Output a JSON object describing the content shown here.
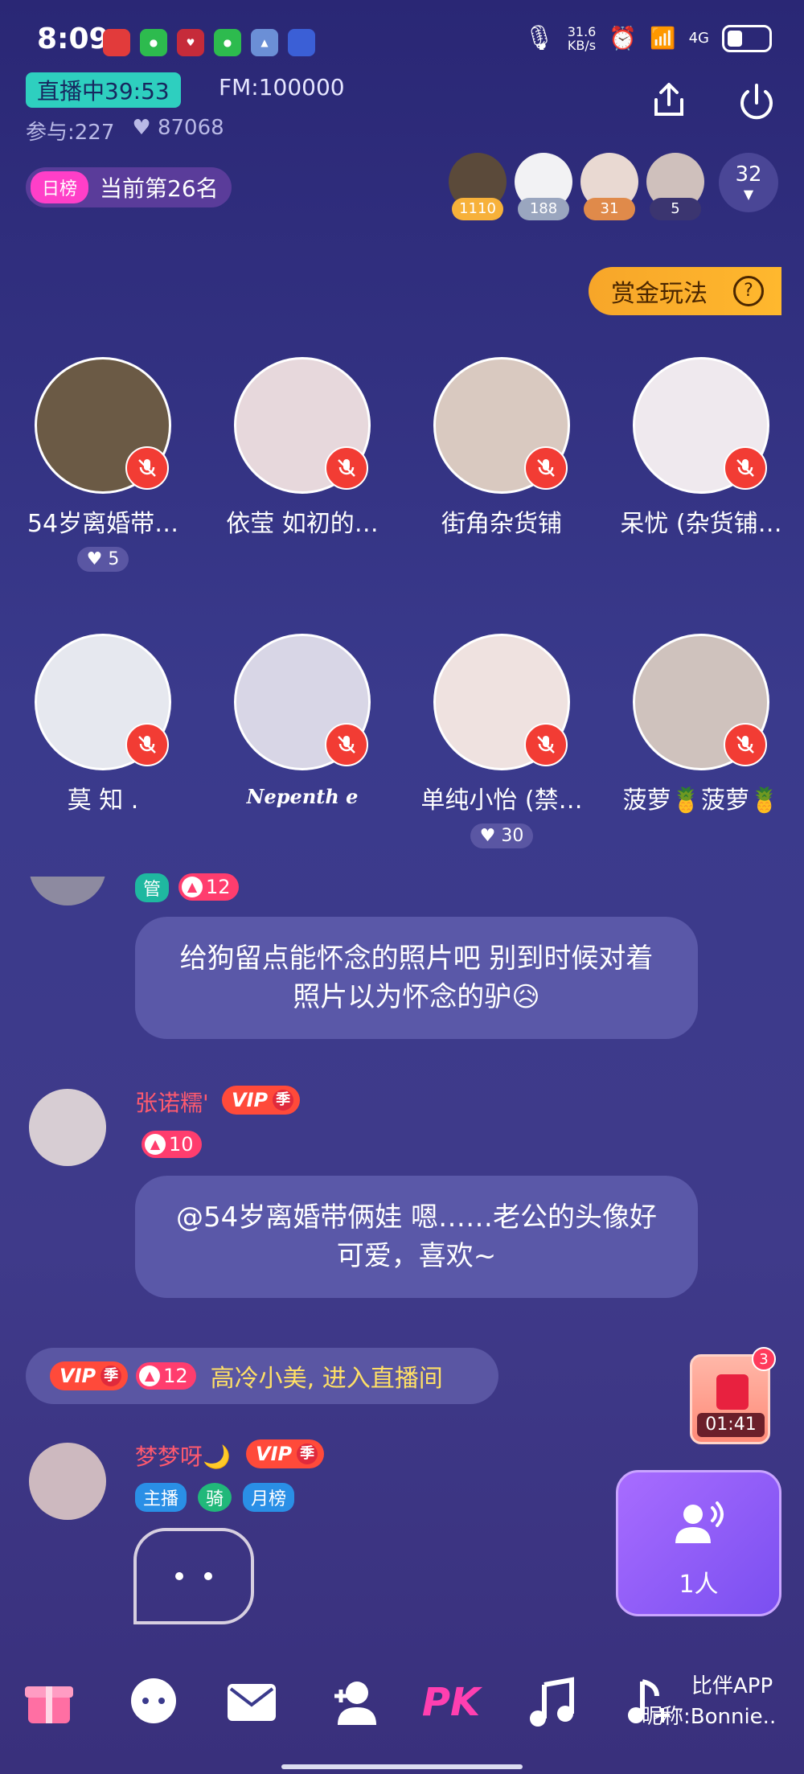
{
  "status_bar": {
    "time": "8:09",
    "net_speed_value": "31.6",
    "net_speed_unit": "KB/s",
    "signal": "4G"
  },
  "header": {
    "live_label": "直播中39:53",
    "fm_label": "FM:100000",
    "participants": "参与:227",
    "likes": "87068",
    "rank_tag": "日榜",
    "rank_text": "当前第26名",
    "viewer_count": "32",
    "top_viewers": [
      {
        "value": "1110",
        "color": "#f7b13a"
      },
      {
        "value": "188",
        "color": "#9aa6bf"
      },
      {
        "value": "31",
        "color": "#e08a4a"
      },
      {
        "value": "5",
        "color": "#3b3570"
      }
    ],
    "bounty_label": "赏金玩法",
    "help_glyph": "?"
  },
  "seats": [
    {
      "name": "54岁离婚带…",
      "likes": "5",
      "avatar_color": "#6b5a45"
    },
    {
      "name": "依莹 如初的…",
      "likes": "",
      "avatar_color": "#e7d8dc"
    },
    {
      "name": "街角杂货铺",
      "likes": "",
      "avatar_color": "#d9c9c0"
    },
    {
      "name": "呆忧 (杂货铺…",
      "likes": "",
      "avatar_color": "#efe9ee"
    },
    {
      "name": "莫 知 .",
      "likes": "",
      "avatar_color": "#e6e8ef"
    },
    {
      "name": "Nepenth e",
      "likes": "",
      "avatar_color": "#d8d6e6"
    },
    {
      "name": "单纯小怡 (禁…",
      "likes": "30",
      "avatar_color": "#efe2e0"
    },
    {
      "name": "菠萝🍍菠萝🍍",
      "likes": "",
      "avatar_color": "#cfc2bd"
    }
  ],
  "chat": {
    "partial_tag_1": "管",
    "partial_level": "12",
    "msg1": "给狗留点能怀念的照片吧 别到时候对着照片以为怀念的驴😥",
    "user2_name": "张诺糯'",
    "user2_level": "10",
    "msg2": "@54岁离婚带俩娃 嗯……老公的头像好可爱，喜欢~",
    "enter_level": "12",
    "enter_text": "高冷小美, 进入直播间",
    "user3_name": "梦梦呀🌙",
    "user3_tags": [
      "主播",
      "骑",
      "月榜"
    ],
    "vip_label": "VIP",
    "vip_season": "季"
  },
  "redpack": {
    "timer": "01:41",
    "badge": "3"
  },
  "mic_queue": {
    "label": "1人"
  },
  "bottom": {
    "pk_label": "PK",
    "brand": "比伴APP",
    "nickname": "昵称:Bonnie.."
  }
}
